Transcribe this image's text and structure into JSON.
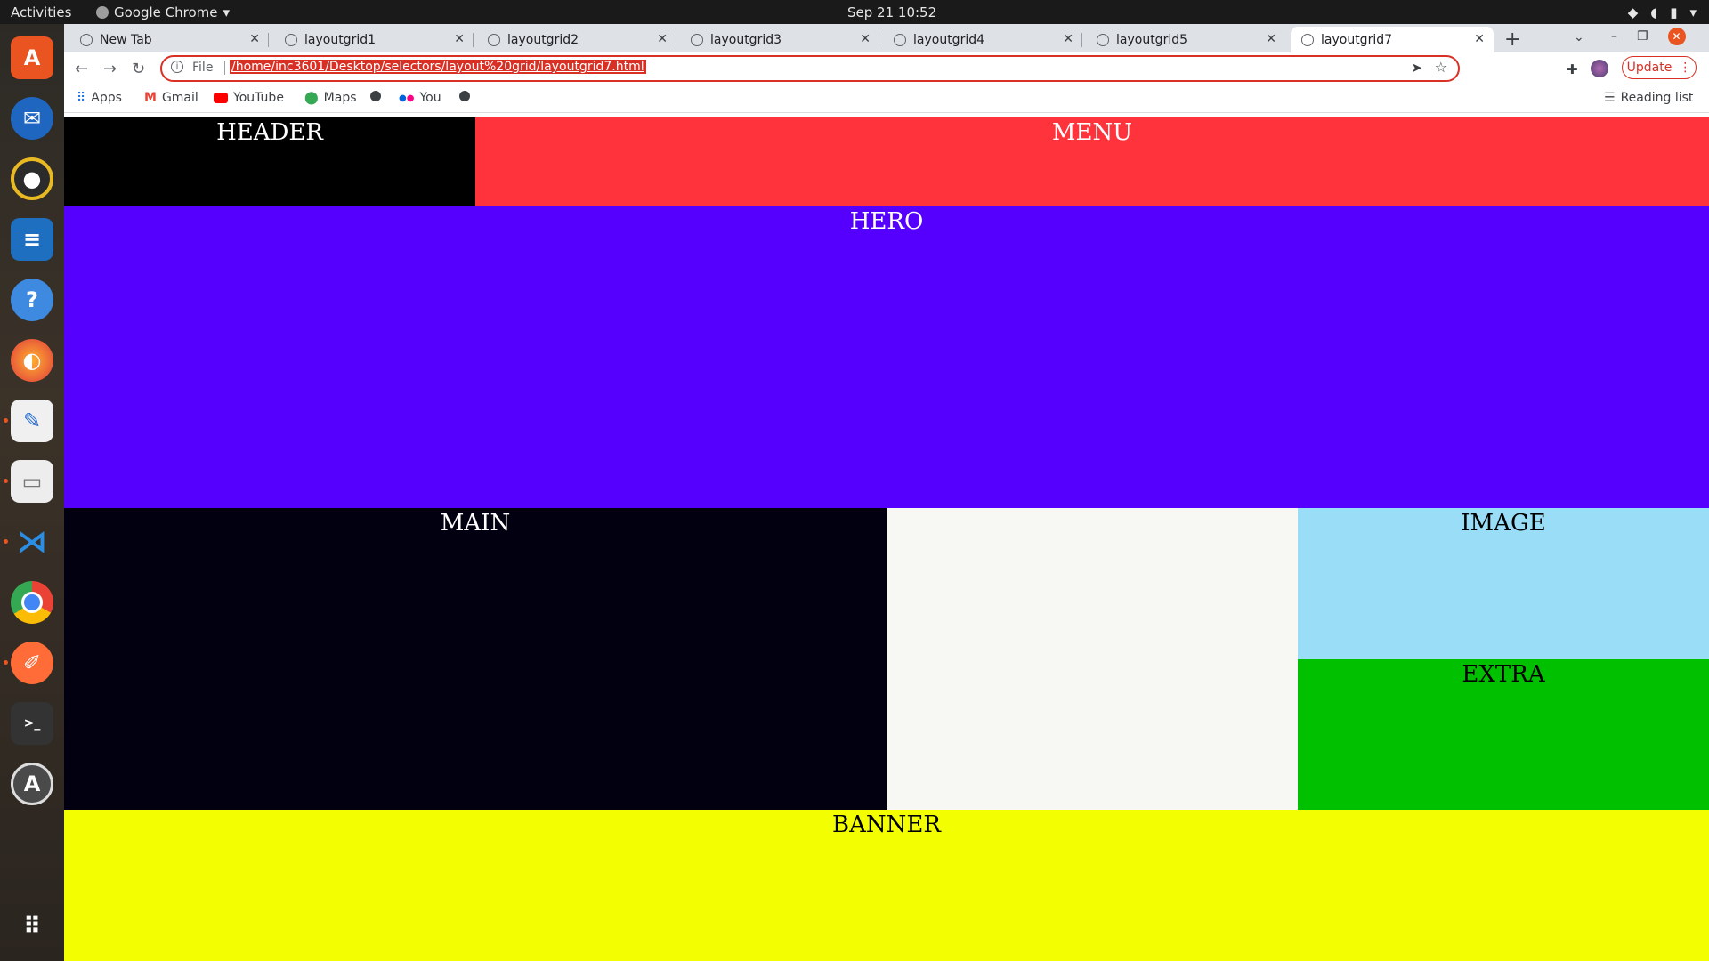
{
  "topbar": {
    "activities": "Activities",
    "app_name": "Google Chrome",
    "clock": "Sep 21  10:52"
  },
  "dock": {
    "items": [
      "ubuntu-software-icon",
      "thunderbird-icon",
      "rhythmbox-icon",
      "writer-icon",
      "help-icon",
      "firefox-icon",
      "text-editor-icon",
      "files-icon",
      "vscode-icon",
      "chrome-icon",
      "postman-icon",
      "terminal-icon",
      "software-updater-icon",
      "show-apps-icon"
    ]
  },
  "browser": {
    "tabs": [
      {
        "label": "New Tab"
      },
      {
        "label": "layoutgrid1"
      },
      {
        "label": "layoutgrid2"
      },
      {
        "label": "layoutgrid3"
      },
      {
        "label": "layoutgrid4"
      },
      {
        "label": "layoutgrid5"
      },
      {
        "label": "layoutgrid7"
      }
    ],
    "active_tab": 6,
    "omnibox": {
      "scheme_label": "File",
      "url": "/home/inc3601/Desktop/selectors/layout%20grid/layoutgrid7.html"
    },
    "update_label": "Update",
    "bookmarks": [
      {
        "label": "Apps"
      },
      {
        "label": "Gmail"
      },
      {
        "label": "YouTube"
      },
      {
        "label": "Maps"
      },
      {
        "label": "You"
      }
    ],
    "reading_list": "Reading list"
  },
  "page": {
    "header": "HEADER",
    "menu": "MENU",
    "hero": "HERO",
    "main": "MAIN",
    "image": "IMAGE",
    "extra": "EXTRA",
    "banner": "BANNER"
  },
  "colors": {
    "header": "#000000",
    "menu": "#ff333c",
    "hero": "#5500ff",
    "main": "#020010",
    "middle": "#f7f7f3",
    "image": "#99ddf7",
    "extra": "#00c000",
    "banner": "#f3ff00"
  }
}
